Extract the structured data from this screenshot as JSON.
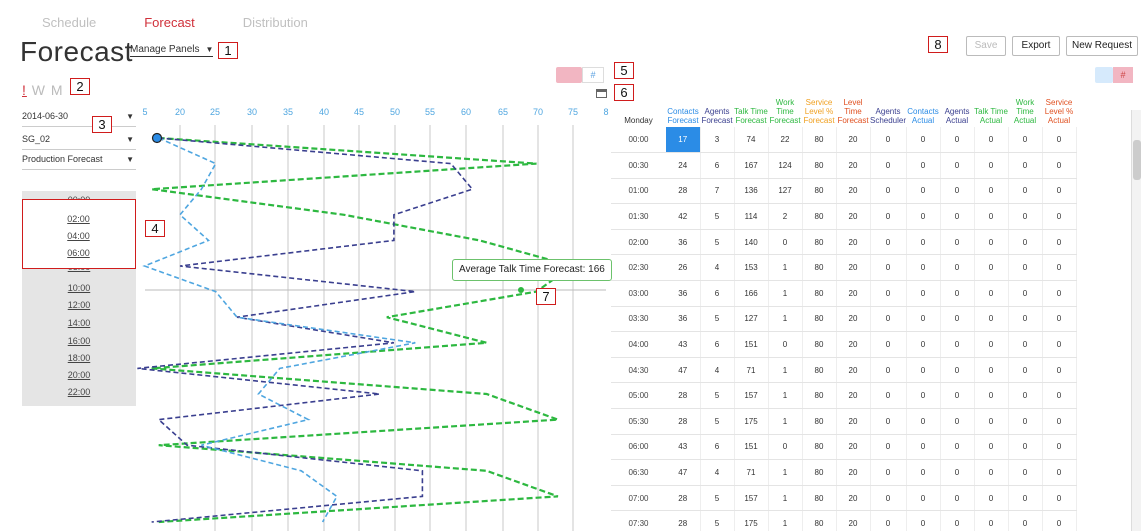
{
  "tabs": [
    {
      "label": "Schedule",
      "active": false
    },
    {
      "label": "Forecast",
      "active": true
    },
    {
      "label": "Distribution",
      "active": false
    }
  ],
  "page_title": "Forecast",
  "manage_panels": "Manage Panels",
  "view_toggle": {
    "items": [
      "!",
      "W",
      "M"
    ],
    "selected": "!"
  },
  "filters": {
    "date": "2014-06-30",
    "skill_group": "SG_02",
    "forecast_type": "Production Forecast"
  },
  "time_slots": [
    "00:00",
    "02:00",
    "04:00",
    "06:00",
    "08:00",
    "10:00",
    "12:00",
    "14:00",
    "16:00",
    "18:00",
    "20:00",
    "22:00"
  ],
  "callouts": [
    "1",
    "2",
    "3",
    "4",
    "5",
    "6",
    "7",
    "8"
  ],
  "buttons": {
    "save": "Save",
    "export": "Export",
    "new_request": "New Request"
  },
  "chart_toggle_icon": "#",
  "table_toggle_icon": "#",
  "tooltip": "Average Talk Time Forecast: 166",
  "chart_data": {
    "type": "line",
    "orientation": "horizontal",
    "x_ticks": [
      "5",
      "20",
      "25",
      "30",
      "35",
      "40",
      "45",
      "50",
      "55",
      "60",
      "65",
      "70",
      "75",
      "8"
    ],
    "y_categories": [
      "00:00",
      "00:30",
      "01:00",
      "01:30",
      "02:00",
      "02:30",
      "03:00",
      "03:30",
      "04:00",
      "04:30",
      "05:00",
      "05:30",
      "06:00",
      "06:30",
      "07:00",
      "07:30"
    ],
    "series": [
      {
        "color": "#2db840",
        "values": [
          17,
          70,
          16,
          43,
          62,
          75,
          70,
          49,
          63,
          16,
          63,
          73,
          17,
          63,
          73,
          17
        ]
      },
      {
        "color": "#3a3f8f",
        "values": [
          17,
          58,
          61,
          50,
          50,
          20,
          53,
          28,
          50,
          14,
          48,
          17,
          21,
          54,
          54,
          16
        ]
      },
      {
        "color": "#4fa6e0",
        "values": [
          17,
          25,
          23,
          20,
          24,
          15,
          25,
          28,
          53,
          34,
          31,
          38,
          23,
          37,
          42,
          40
        ]
      }
    ],
    "colors": {
      "green": "#2db840",
      "navy": "#3a3f8f",
      "blue": "#4fa6e0",
      "grid": "#c9c9c9"
    }
  },
  "table": {
    "day_label": "Monday",
    "headers": [
      {
        "label": "Contacts Forecast",
        "color": "#2b8ce6"
      },
      {
        "label": "Agents Forecast",
        "color": "#3a3f8f"
      },
      {
        "label": "Talk Time Forecast",
        "color": "#2db840"
      },
      {
        "label": "Work Time Forecast",
        "color": "#2db840"
      },
      {
        "label": "Service Level % Forecast",
        "color": "#f0a020"
      },
      {
        "label": "Level Time Forecast",
        "color": "#e05020"
      },
      {
        "label": "Agents Scheduler",
        "color": "#3a3f8f"
      },
      {
        "label": "Contacts Actual",
        "color": "#2b8ce6"
      },
      {
        "label": "Agents Actual",
        "color": "#3a3f8f"
      },
      {
        "label": "Talk Time Actual",
        "color": "#2db840"
      },
      {
        "label": "Work Time Actual",
        "color": "#2db840"
      },
      {
        "label": "Service Level % Actual",
        "color": "#e05020"
      }
    ],
    "rows": [
      {
        "time": "00:00",
        "cells": [
          "17",
          "3",
          "74",
          "22",
          "80",
          "20",
          "0",
          "0",
          "0",
          "0",
          "0",
          "0"
        ]
      },
      {
        "time": "00:30",
        "cells": [
          "24",
          "6",
          "167",
          "124",
          "80",
          "20",
          "0",
          "0",
          "0",
          "0",
          "0",
          "0"
        ]
      },
      {
        "time": "01:00",
        "cells": [
          "28",
          "7",
          "136",
          "127",
          "80",
          "20",
          "0",
          "0",
          "0",
          "0",
          "0",
          "0"
        ]
      },
      {
        "time": "01:30",
        "cells": [
          "42",
          "5",
          "114",
          "2",
          "80",
          "20",
          "0",
          "0",
          "0",
          "0",
          "0",
          "0"
        ]
      },
      {
        "time": "02:00",
        "cells": [
          "36",
          "5",
          "140",
          "0",
          "80",
          "20",
          "0",
          "0",
          "0",
          "0",
          "0",
          "0"
        ]
      },
      {
        "time": "02:30",
        "cells": [
          "26",
          "4",
          "153",
          "1",
          "80",
          "20",
          "0",
          "0",
          "0",
          "0",
          "0",
          "0"
        ]
      },
      {
        "time": "03:00",
        "cells": [
          "36",
          "6",
          "166",
          "1",
          "80",
          "20",
          "0",
          "0",
          "0",
          "0",
          "0",
          "0"
        ]
      },
      {
        "time": "03:30",
        "cells": [
          "36",
          "5",
          "127",
          "1",
          "80",
          "20",
          "0",
          "0",
          "0",
          "0",
          "0",
          "0"
        ]
      },
      {
        "time": "04:00",
        "cells": [
          "43",
          "6",
          "151",
          "0",
          "80",
          "20",
          "0",
          "0",
          "0",
          "0",
          "0",
          "0"
        ]
      },
      {
        "time": "04:30",
        "cells": [
          "47",
          "4",
          "71",
          "1",
          "80",
          "20",
          "0",
          "0",
          "0",
          "0",
          "0",
          "0"
        ]
      },
      {
        "time": "05:00",
        "cells": [
          "28",
          "5",
          "157",
          "1",
          "80",
          "20",
          "0",
          "0",
          "0",
          "0",
          "0",
          "0"
        ]
      },
      {
        "time": "05:30",
        "cells": [
          "28",
          "5",
          "175",
          "1",
          "80",
          "20",
          "0",
          "0",
          "0",
          "0",
          "0",
          "0"
        ]
      },
      {
        "time": "06:00",
        "cells": [
          "43",
          "6",
          "151",
          "0",
          "80",
          "20",
          "0",
          "0",
          "0",
          "0",
          "0",
          "0"
        ]
      },
      {
        "time": "06:30",
        "cells": [
          "47",
          "4",
          "71",
          "1",
          "80",
          "20",
          "0",
          "0",
          "0",
          "0",
          "0",
          "0"
        ]
      },
      {
        "time": "07:00",
        "cells": [
          "28",
          "5",
          "157",
          "1",
          "80",
          "20",
          "0",
          "0",
          "0",
          "0",
          "0",
          "0"
        ]
      },
      {
        "time": "07:30",
        "cells": [
          "28",
          "5",
          "175",
          "1",
          "80",
          "20",
          "0",
          "0",
          "0",
          "0",
          "0",
          "0"
        ]
      }
    ]
  }
}
